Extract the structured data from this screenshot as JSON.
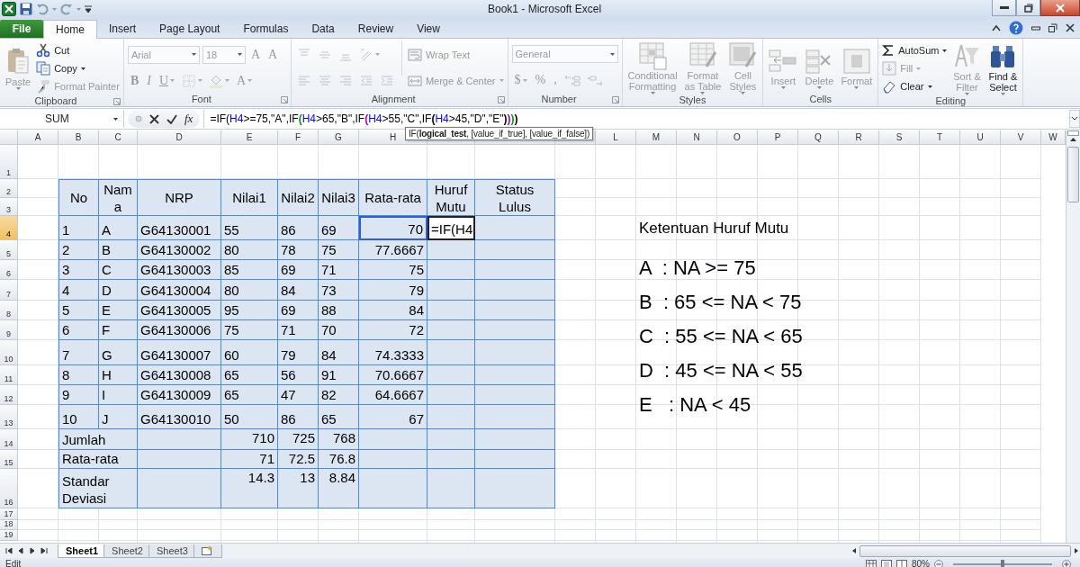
{
  "window": {
    "title": "Book1 - Microsoft Excel"
  },
  "ribbon_tabs": [
    {
      "label": "File",
      "kind": "file",
      "selected": false
    },
    {
      "label": "Home",
      "kind": "tab",
      "selected": true
    },
    {
      "label": "Insert",
      "kind": "tab",
      "selected": false
    },
    {
      "label": "Page Layout",
      "kind": "tab",
      "selected": false
    },
    {
      "label": "Formulas",
      "kind": "tab",
      "selected": false
    },
    {
      "label": "Data",
      "kind": "tab",
      "selected": false
    },
    {
      "label": "Review",
      "kind": "tab",
      "selected": false
    },
    {
      "label": "View",
      "kind": "tab",
      "selected": false
    }
  ],
  "ribbon": [
    {
      "label": "Clipboard",
      "launcher": true,
      "columns": [
        [
          [
            {
              "kind": "large",
              "lines": [
                "Paste"
              ],
              "dropdown": true,
              "disabled": true
            }
          ]
        ],
        [
          [
            {
              "kind": "small",
              "label": "Cut",
              "dropdown": false,
              "disabled": false
            }
          ],
          [
            {
              "kind": "small",
              "label": "Copy",
              "dropdown": true,
              "disabled": false
            }
          ],
          [
            {
              "kind": "small",
              "label": "Format Painter",
              "dropdown": false,
              "disabled": true
            }
          ]
        ]
      ]
    },
    {
      "label": "Font",
      "launcher": true,
      "columns": [
        [
          [
            {
              "kind": "combo",
              "value": "Arial",
              "disabled": true
            },
            {
              "kind": "combo",
              "value": "18",
              "disabled": true
            },
            {
              "kind": "glyph",
              "label": "A",
              "dropdown": false,
              "disabled": true
            },
            {
              "kind": "glyph",
              "label": "A",
              "dropdown": false,
              "disabled": true
            }
          ],
          [
            {
              "kind": "bold",
              "label": "B",
              "dropdown": false,
              "disabled": true
            },
            {
              "kind": "italic",
              "label": "I",
              "dropdown": false,
              "disabled": true
            },
            {
              "kind": "underline",
              "label": "U",
              "dropdown": true,
              "disabled": true
            },
            {
              "kind": "icon",
              "dropdown": true,
              "disabled": true
            },
            {
              "kind": "icon",
              "dropdown": true,
              "disabled": true
            },
            {
              "kind": "glyph",
              "label": "A",
              "dropdown": true,
              "disabled": true
            }
          ]
        ]
      ]
    },
    {
      "label": "Alignment",
      "launcher": true,
      "columns": [
        [
          [
            {
              "kind": "icon",
              "dropdown": false,
              "disabled": true
            },
            {
              "kind": "icon",
              "dropdown": false,
              "disabled": true
            },
            {
              "kind": "icon",
              "dropdown": false,
              "disabled": true
            },
            {
              "kind": "icon",
              "dropdown": true,
              "disabled": true
            }
          ],
          [
            {
              "kind": "icon",
              "dropdown": false,
              "disabled": true
            },
            {
              "kind": "icon",
              "dropdown": false,
              "disabled": true
            },
            {
              "kind": "icon",
              "dropdown": false,
              "disabled": true
            },
            {
              "kind": "icon",
              "dropdown": false,
              "disabled": true
            },
            {
              "kind": "icon",
              "dropdown": false,
              "disabled": true
            }
          ]
        ],
        [
          [
            {
              "kind": "small",
              "label": "Wrap Text",
              "dropdown": false,
              "disabled": true
            }
          ],
          [
            {
              "kind": "small",
              "label": "Merge & Center",
              "dropdown": true,
              "disabled": true
            }
          ]
        ]
      ]
    },
    {
      "label": "Number",
      "launcher": true,
      "columns": [
        [
          [
            {
              "kind": "combo",
              "value": "General",
              "disabled": true
            }
          ],
          [
            {
              "kind": "glyph",
              "label": "$",
              "dropdown": true,
              "disabled": true
            },
            {
              "kind": "glyph",
              "label": "%",
              "dropdown": false,
              "disabled": true
            },
            {
              "kind": "glyph",
              "label": ",",
              "dropdown": false,
              "disabled": true
            },
            {
              "kind": "icon",
              "dropdown": false,
              "disabled": true
            },
            {
              "kind": "icon",
              "dropdown": false,
              "disabled": true
            }
          ]
        ]
      ]
    },
    {
      "label": "Styles",
      "launcher": false,
      "columns": [
        [
          [
            {
              "kind": "large",
              "lines": [
                "Conditional",
                "Formatting"
              ],
              "dropdown": true,
              "disabled": true
            }
          ]
        ],
        [
          [
            {
              "kind": "large",
              "lines": [
                "Format",
                "as Table"
              ],
              "dropdown": true,
              "disabled": true
            }
          ]
        ],
        [
          [
            {
              "kind": "large",
              "lines": [
                "Cell",
                "Styles"
              ],
              "dropdown": true,
              "disabled": true
            }
          ]
        ]
      ]
    },
    {
      "label": "Cells",
      "launcher": false,
      "columns": [
        [
          [
            {
              "kind": "large",
              "lines": [
                "Insert"
              ],
              "dropdown": true,
              "disabled": true
            }
          ]
        ],
        [
          [
            {
              "kind": "large",
              "lines": [
                "Delete"
              ],
              "dropdown": true,
              "disabled": true
            }
          ]
        ],
        [
          [
            {
              "kind": "large",
              "lines": [
                "Format"
              ],
              "dropdown": true,
              "disabled": true
            }
          ]
        ]
      ]
    },
    {
      "label": "Editing",
      "launcher": false,
      "columns": [
        [
          [
            {
              "kind": "small",
              "label": "AutoSum",
              "dropdown": true,
              "disabled": false
            }
          ],
          [
            {
              "kind": "small",
              "label": "Fill",
              "dropdown": true,
              "disabled": true
            }
          ],
          [
            {
              "kind": "small",
              "label": "Clear",
              "dropdown": true,
              "disabled": false
            }
          ]
        ],
        [
          [
            {
              "kind": "large",
              "lines": [
                "Sort &",
                "Filter"
              ],
              "dropdown": true,
              "disabled": true
            }
          ]
        ],
        [
          [
            {
              "kind": "large",
              "lines": [
                "Find &",
                "Select"
              ],
              "dropdown": true,
              "disabled": false
            }
          ]
        ]
      ]
    }
  ],
  "formula_bar": {
    "name_box": "SUM",
    "insert_function": "fx",
    "segments": [
      {
        "text": "=IF(",
        "color": "#000000"
      },
      {
        "text": "H4",
        "color": "#0000ff"
      },
      {
        "text": ">=75,\"A\",IF",
        "color": "#000000"
      },
      {
        "text": "(",
        "color": "#00a000"
      },
      {
        "text": "H4",
        "color": "#0000ff"
      },
      {
        "text": ">65,\"B\",IF",
        "color": "#000000"
      },
      {
        "text": "(",
        "color": "#a000c0"
      },
      {
        "text": "H4",
        "color": "#0000ff"
      },
      {
        "text": ">55,\"C\",IF",
        "color": "#000000"
      },
      {
        "text": "(",
        "color": "#000000"
      },
      {
        "text": "H4",
        "color": "#0000ff"
      },
      {
        "text": ">45,\"D\",\"E\"",
        "color": "#000000"
      },
      {
        "text": ")",
        "color": "#000000"
      },
      {
        "text": ")",
        "color": "#a000c0"
      },
      {
        "text": ")",
        "color": "#00a000"
      },
      {
        "text": ")",
        "color": "#000000"
      }
    ]
  },
  "tooltip": "IF(**logical_test**, [value_if_true], [value_if_false])",
  "sheet": {
    "column_headers_left": [
      "A",
      "B",
      "C",
      "D",
      "E",
      "F",
      "G",
      "H"
    ],
    "column_headers_right": [
      "L",
      "M",
      "N",
      "O",
      "P",
      "Q",
      "R",
      "S",
      "T",
      "U",
      "V",
      "W"
    ],
    "row_headers": [
      {
        "label": "1",
        "selected": false
      },
      {
        "label": "2",
        "selected": false
      },
      {
        "label": "3",
        "selected": false
      },
      {
        "label": "4",
        "selected": true
      },
      {
        "label": "5",
        "selected": false
      },
      {
        "label": "6",
        "selected": false
      },
      {
        "label": "7",
        "selected": false
      },
      {
        "label": "8",
        "selected": false
      },
      {
        "label": "9",
        "selected": false
      },
      {
        "label": "10",
        "selected": false
      },
      {
        "label": "11",
        "selected": false
      },
      {
        "label": "12",
        "selected": false
      },
      {
        "label": "13",
        "selected": false
      },
      {
        "label": "14",
        "selected": false
      },
      {
        "label": "15",
        "selected": false
      },
      {
        "label": "16",
        "selected": false
      },
      {
        "label": "17",
        "selected": false
      },
      {
        "label": "18",
        "selected": false
      },
      {
        "label": "19",
        "selected": false
      }
    ]
  },
  "table": {
    "header": [
      "No",
      "Nama",
      "NRP",
      "Nilai1",
      "Nilai2",
      "Nilai3",
      "Rata-rata",
      "Huruf Mutu",
      "Status Lulus"
    ],
    "rows": [
      {
        "cells": [
          "1",
          "A",
          "G64130001",
          "55",
          "86",
          "69",
          "70"
        ],
        "highlight_average": true,
        "editing": [
          {
            "text": "=IF(",
            "color": "#000000"
          },
          {
            "text": "H4",
            "color": "#000000"
          }
        ]
      },
      {
        "cells": [
          "2",
          "B",
          "G64130002",
          "80",
          "78",
          "75",
          "77.6667"
        ],
        "highlight_average": false
      },
      {
        "cells": [
          "3",
          "C",
          "G64130003",
          "85",
          "69",
          "71",
          "75"
        ],
        "highlight_average": false
      },
      {
        "cells": [
          "4",
          "D",
          "G64130004",
          "80",
          "84",
          "73",
          "79"
        ],
        "highlight_average": false
      },
      {
        "cells": [
          "5",
          "E",
          "G64130005",
          "95",
          "69",
          "88",
          "84"
        ],
        "highlight_average": false
      },
      {
        "cells": [
          "6",
          "F",
          "G64130006",
          "75",
          "71",
          "70",
          "72"
        ],
        "highlight_average": false
      },
      {
        "cells": [
          "7",
          "G",
          "G64130007",
          "60",
          "79",
          "84",
          "74.3333"
        ],
        "highlight_average": false
      },
      {
        "cells": [
          "8",
          "H",
          "G64130008",
          "65",
          "56",
          "91",
          "70.6667"
        ],
        "highlight_average": false
      },
      {
        "cells": [
          "9",
          "I",
          "G64130009",
          "65",
          "47",
          "82",
          "64.6667"
        ],
        "highlight_average": false
      },
      {
        "cells": [
          "10",
          "J",
          "G64130010",
          "50",
          "86",
          "65",
          "67"
        ],
        "highlight_average": false
      }
    ],
    "summary": [
      {
        "label": "Jumlah",
        "values": [
          "710",
          "725",
          "768"
        ]
      },
      {
        "label": "Rata-rata",
        "values": [
          "71",
          "72.5",
          "76.8"
        ]
      },
      {
        "label": "Standar Deviasi",
        "values": [
          "14.3",
          "13",
          "8.84"
        ]
      }
    ]
  },
  "notes": {
    "title": "Ketentuan Huruf Mutu",
    "rules": [
      "A  : NA >= 75",
      "B  : 65 <= NA < 75",
      "C  : 55 <= NA < 65",
      "D  : 45 <= NA < 55",
      "E   : NA < 45"
    ]
  },
  "sheet_tabs": [
    {
      "label": "Sheet1",
      "selected": true
    },
    {
      "label": "Sheet2",
      "selected": false
    },
    {
      "label": "Sheet3",
      "selected": false
    }
  ],
  "status_bar": {
    "mode": "Edit",
    "zoom": "80%",
    "zoom_slider": {
      "level": 0.5
    }
  }
}
